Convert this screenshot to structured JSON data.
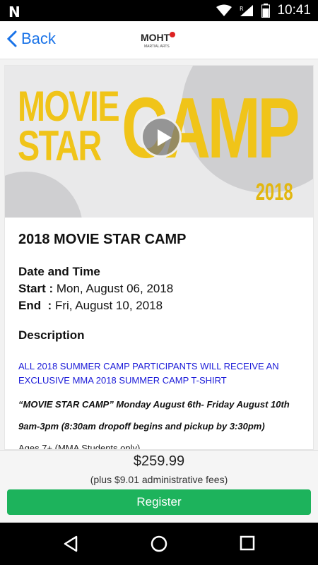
{
  "status_bar": {
    "time": "10:41",
    "icons": [
      "notification-n-icon",
      "wifi-icon",
      "signal-icon",
      "battery-icon"
    ]
  },
  "nav": {
    "back_label": "Back",
    "logo_text": "MOHT",
    "logo_subtext": "MARTIAL ARTS"
  },
  "hero": {
    "line1": "MOVIE",
    "line2": "STAR",
    "camp": "CAMP",
    "year": "2018",
    "accent_color": "#f0c419"
  },
  "event": {
    "title": "2018 MOVIE STAR CAMP",
    "date_time_heading": "Date and Time",
    "start_label": "Start :",
    "start_value": "Mon, August 06, 2018",
    "end_label": "End  :",
    "end_value": "Fri, August 10, 2018",
    "description_heading": "Description",
    "promo_text": "ALL 2018 SUMMER CAMP PARTICIPANTS WILL RECEIVE AN EXCLUSIVE MMA 2018 SUMMER CAMP T-SHIRT",
    "camp_dates_line": "“MOVIE STAR CAMP” Monday August 6th- Friday August 10th",
    "hours_line": "9am-3pm (8:30am dropoff begins and pickup by 3:30pm)",
    "ages_line": "Ages 7+ (MMA Students only)"
  },
  "footer": {
    "price": "$259.99",
    "fees": "(plus $9.01 administrative fees)",
    "register_label": "Register",
    "register_color": "#1db35c"
  }
}
